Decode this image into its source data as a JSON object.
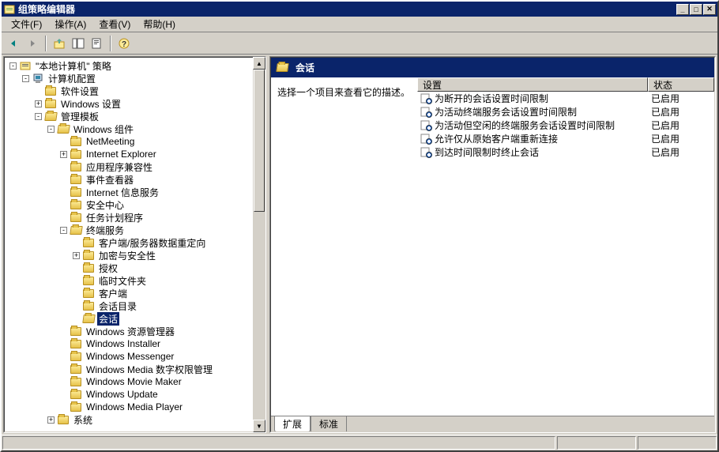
{
  "window": {
    "title": "组策略编辑器"
  },
  "menubar": [
    "文件(F)",
    "操作(A)",
    "查看(V)",
    "帮助(H)"
  ],
  "tree": {
    "root": {
      "label": "\"本地计算机\" 策略"
    },
    "computer_config": "计算机配置",
    "software_settings": "软件设置",
    "windows_settings": "Windows 设置",
    "admin_templates": "管理模板",
    "windows_components": "Windows 组件",
    "netmeeting": "NetMeeting",
    "ie": "Internet Explorer",
    "app_compat": "应用程序兼容性",
    "event_viewer": "事件查看器",
    "iis": "Internet 信息服务",
    "security_center": "安全中心",
    "task_scheduler": "任务计划程序",
    "terminal_services": "终端服务",
    "client_server_redirect": "客户端/服务器数据重定向",
    "encryption_security": "加密与安全性",
    "licensing": "授权",
    "temp_folders": "临时文件夹",
    "client": "客户端",
    "session_dir": "会话目录",
    "sessions": "会话",
    "windows_explorer": "Windows 资源管理器",
    "windows_installer": "Windows Installer",
    "windows_messenger": "Windows Messenger",
    "windows_media_drm": "Windows Media 数字权限管理",
    "windows_movie_maker": "Windows Movie Maker",
    "windows_update": "Windows Update",
    "windows_media_player": "Windows Media Player",
    "system": "系统"
  },
  "right": {
    "title": "会话",
    "description": "选择一个项目来查看它的描述。",
    "columns": {
      "setting": "设置",
      "status": "状态"
    },
    "items": [
      {
        "name": "为断开的会话设置时间限制",
        "status": "已启用"
      },
      {
        "name": "为活动终端服务会话设置时间限制",
        "status": "已启用"
      },
      {
        "name": "为活动但空闲的终端服务会话设置时间限制",
        "status": "已启用"
      },
      {
        "name": "允许仅从原始客户端重新连接",
        "status": "已启用"
      },
      {
        "name": "到达时间限制时终止会话",
        "status": "已启用"
      }
    ]
  },
  "tabs": {
    "extended": "扩展",
    "standard": "标准"
  }
}
